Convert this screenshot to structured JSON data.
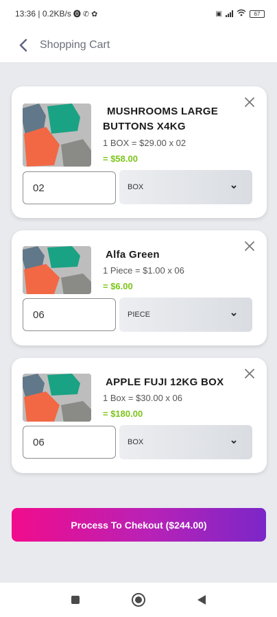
{
  "status_bar": {
    "time_speed": "13:36 | 0.2KB/s",
    "battery": "67"
  },
  "header": {
    "title": "Shopping Cart"
  },
  "icons": {
    "back": "back-arrow-icon",
    "close": "close-icon",
    "dropdown": "chevron-down-icon",
    "nav_recents": "square-icon",
    "nav_home": "circle-icon",
    "nav_back": "triangle-back-icon"
  },
  "cart": {
    "items": [
      {
        "name": "MUSHROOMS LARGE BUTTONS X4KG",
        "detail": "1 BOX = $29.00 x 02",
        "total": "= $58.00",
        "quantity": "02",
        "unit": "BOX"
      },
      {
        "name": "Alfa Green",
        "detail": "1 Piece = $1.00 x 06",
        "total": "= $6.00",
        "quantity": "06",
        "unit": "PIECE"
      },
      {
        "name": "APPLE FUJI 12KG BOX",
        "detail": "1 Box = $30.00 x 06",
        "total": "= $180.00",
        "quantity": "06",
        "unit": "BOX"
      }
    ]
  },
  "checkout": {
    "label": "Process To Chekout ($244.00)"
  },
  "colors": {
    "accent_start": "#f10c8c",
    "accent_end": "#7c26c8",
    "price_green": "#7cc41a",
    "page_bg": "#e8eaee"
  }
}
